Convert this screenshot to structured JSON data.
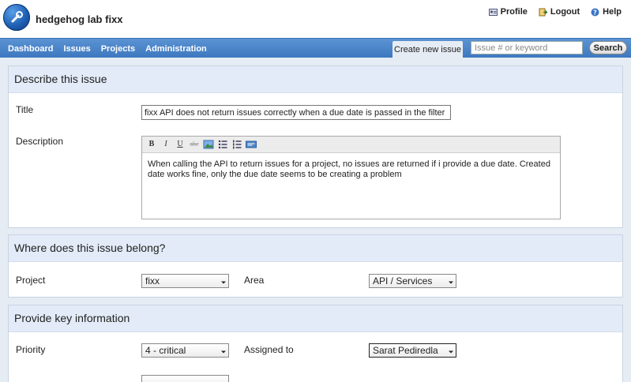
{
  "app": {
    "title": "hedgehog lab fixx"
  },
  "toplinks": [
    {
      "label": "Profile",
      "icon": "profile-icon"
    },
    {
      "label": "Logout",
      "icon": "logout-icon"
    },
    {
      "label": "Help",
      "icon": "help-icon"
    }
  ],
  "nav": {
    "items": [
      "Dashboard",
      "Issues",
      "Projects",
      "Administration"
    ],
    "active_tab": "Create new issue",
    "search_placeholder": "Issue # or keyword",
    "search_button": "Search"
  },
  "describe": {
    "heading": "Describe this issue",
    "title_label": "Title",
    "title_value": "fixx API does not return issues correctly when a due date is passed in the filter",
    "description_label": "Description",
    "description_text": "When calling the API to return issues for a project, no issues are returned if i provide a due date. Created date works fine, only the due date seems to be creating a problem",
    "toolbar": [
      "B",
      "I",
      "U",
      "abc"
    ]
  },
  "belong": {
    "heading": "Where does this issue belong?",
    "project_label": "Project",
    "project_value": "fixx",
    "area_label": "Area",
    "area_value": "API / Services"
  },
  "key_info": {
    "heading": "Provide key information",
    "priority_label": "Priority",
    "priority_value": "4 - critical",
    "assigned_label": "Assigned to",
    "assigned_value": "Sarat Pediredla"
  },
  "colors": {
    "nav": "#4a84c8",
    "panel_head": "#e2ebf7",
    "page_bg": "#e6ecf4"
  }
}
